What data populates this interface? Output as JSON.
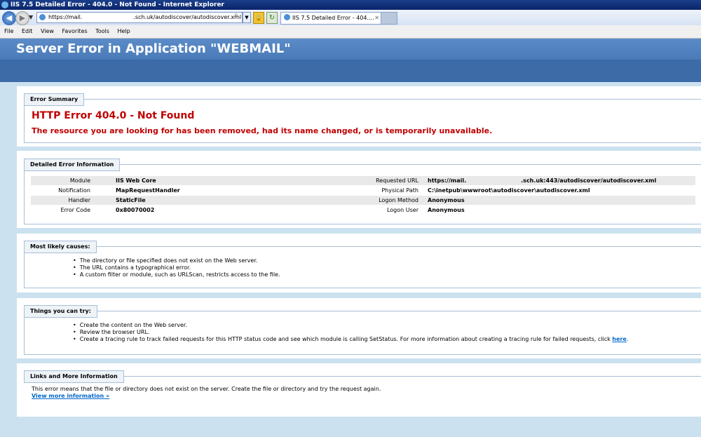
{
  "window": {
    "title": "IIS 7.5 Detailed Error - 404.0 - Not Found - Internet Explorer"
  },
  "browser": {
    "url_prefix": "https://mail.",
    "url_suffix": ".sch.uk/autodiscover/autodiscover.xml",
    "tab_label": "IIS 7.5 Detailed Error - 404....",
    "tab_close": "✕"
  },
  "menu": [
    "File",
    "Edit",
    "View",
    "Favorites",
    "Tools",
    "Help"
  ],
  "header": {
    "title": "Server Error in Application \"WEBMAIL\""
  },
  "summary": {
    "legend": "Error Summary",
    "title": "HTTP Error 404.0 - Not Found",
    "subtitle": "The resource you are looking for has been removed, had its name changed, or is temporarily unavailable."
  },
  "detail": {
    "legend": "Detailed Error Information",
    "left": [
      {
        "label": "Module",
        "value": "IIS Web Core"
      },
      {
        "label": "Notification",
        "value": "MapRequestHandler"
      },
      {
        "label": "Handler",
        "value": "StaticFile"
      },
      {
        "label": "Error Code",
        "value": "0x80070002"
      }
    ],
    "right": [
      {
        "label": "Requested URL",
        "value_prefix": "https://mail.",
        "value_suffix": ".sch.uk:443/autodiscover/autodiscover.xml"
      },
      {
        "label": "Physical Path",
        "value": "C:\\inetpub\\wwwroot\\autodiscover\\autodiscover.xml"
      },
      {
        "label": "Logon Method",
        "value": "Anonymous"
      },
      {
        "label": "Logon User",
        "value": "Anonymous"
      }
    ]
  },
  "causes": {
    "legend": "Most likely causes:",
    "items": [
      "The directory or file specified does not exist on the Web server.",
      "The URL contains a typographical error.",
      "A custom filter or module, such as URLScan, restricts access to the file."
    ]
  },
  "try": {
    "legend": "Things you can try:",
    "items": [
      "Create the content on the Web server.",
      "Review the browser URL."
    ],
    "item3_text": "Create a tracing rule to track failed requests for this HTTP status code and see which module is calling SetStatus. For more information about creating a tracing rule for failed requests, click ",
    "item3_link": "here",
    "item3_end": "."
  },
  "links": {
    "legend": "Links and More Information",
    "text": "This error means that the file or directory does not exist on the server. Create the file or directory and try the request again.",
    "more": "View more information »"
  }
}
